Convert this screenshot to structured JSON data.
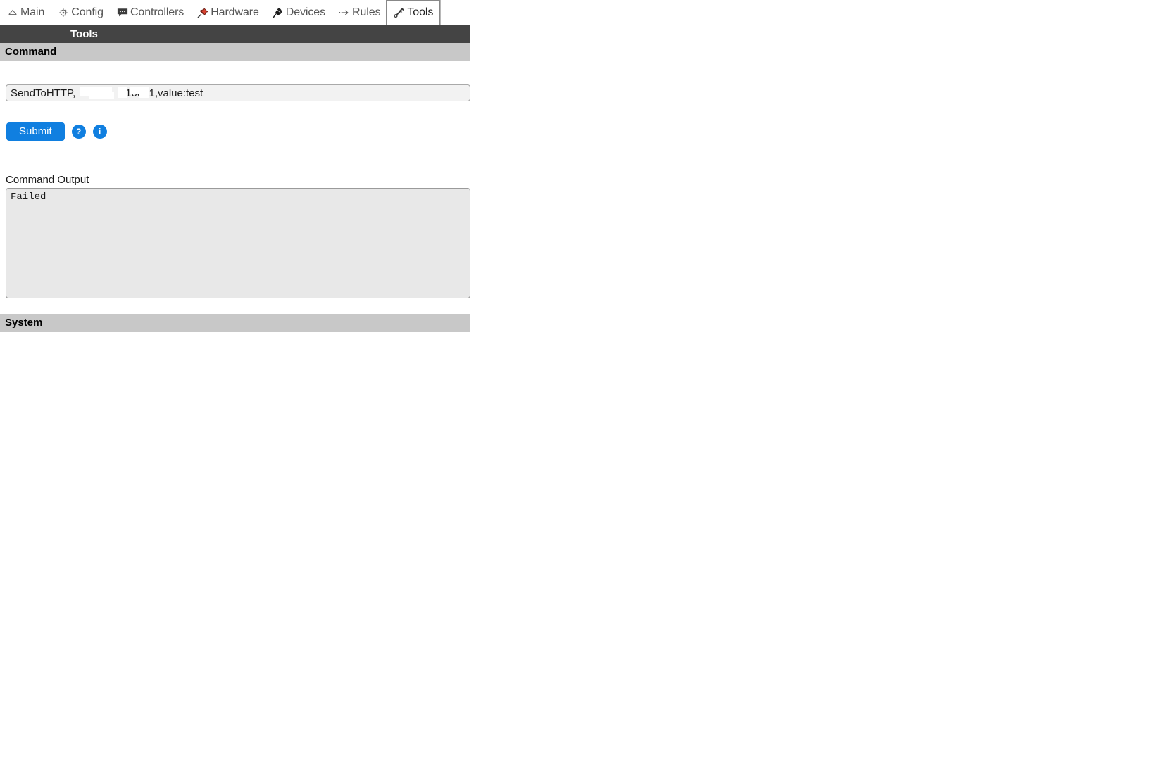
{
  "window": {
    "app_title": "Tools"
  },
  "tabs": [
    {
      "label": "Main",
      "icon": "home-icon",
      "active": false
    },
    {
      "label": "Config",
      "icon": "gear-icon",
      "active": false
    },
    {
      "label": "Controllers",
      "icon": "speech-bubble-icon",
      "active": false
    },
    {
      "label": "Hardware",
      "icon": "pushpin-icon",
      "active": false
    },
    {
      "label": "Devices",
      "icon": "plug-icon",
      "active": false
    },
    {
      "label": "Rules",
      "icon": "arrow-right-icon",
      "active": false
    },
    {
      "label": "Tools",
      "icon": "wrench-icon",
      "active": true
    }
  ],
  "page": {
    "title": "Tools",
    "sections": {
      "command": "Command",
      "system": "System"
    }
  },
  "command_form": {
    "input_value": "SendToHTTP,                ,10051,value:test",
    "input_placeholder": "",
    "submit_label": "Submit",
    "help_label": "?",
    "info_label": "i",
    "output_label": "Command Output",
    "output_value": "Failed"
  },
  "colors": {
    "accent_blue": "#107fe0",
    "title_bar": "#444444",
    "section_bar": "#c8c8c8",
    "output_bg": "#e8e8e8",
    "pushpin_red": "#d8412f"
  }
}
